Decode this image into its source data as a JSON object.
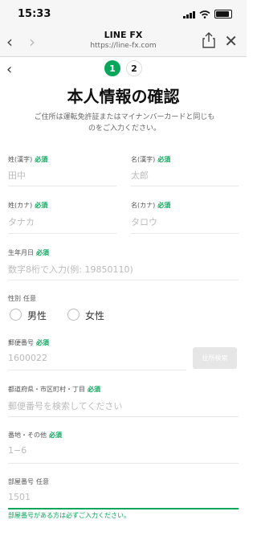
{
  "status_bar": {
    "time": "15:33"
  },
  "browser": {
    "title": "LINE FX",
    "url": "https://line-fx.com",
    "back": "‹",
    "forward": "›",
    "close": "✕"
  },
  "page": {
    "back": "‹",
    "steps": [
      "1",
      "2"
    ],
    "title": "本人情報の確認",
    "description": "ご住所は運転免許証またはマイナンバーカードと同じものをご入力ください。"
  },
  "labels": {
    "required": "必須",
    "optional": "任意"
  },
  "fields": {
    "last_name_kanji": {
      "label": "姓(漢字)",
      "placeholder": "田中"
    },
    "first_name_kanji": {
      "label": "名(漢字)",
      "placeholder": "太郎"
    },
    "last_name_kana": {
      "label": "姓(カナ)",
      "placeholder": "タナカ"
    },
    "first_name_kana": {
      "label": "名(カナ)",
      "placeholder": "タロウ"
    },
    "birthdate": {
      "label": "生年月日",
      "placeholder": "数字8桁で入力(例: 19850110)"
    },
    "gender": {
      "label": "性別",
      "options": [
        "男性",
        "女性"
      ]
    },
    "postal_code": {
      "label": "郵便番号",
      "placeholder": "1600022",
      "button": "住所検索"
    },
    "prefecture_city": {
      "label": "都道府県・市区町村・丁目",
      "placeholder": "郵便番号を検索してください"
    },
    "street": {
      "label": "番地・その他",
      "placeholder": "1−6"
    },
    "room": {
      "label": "部屋番号",
      "placeholder": "1501",
      "hint": "部屋番号がある方は必ずご入力ください。"
    }
  }
}
